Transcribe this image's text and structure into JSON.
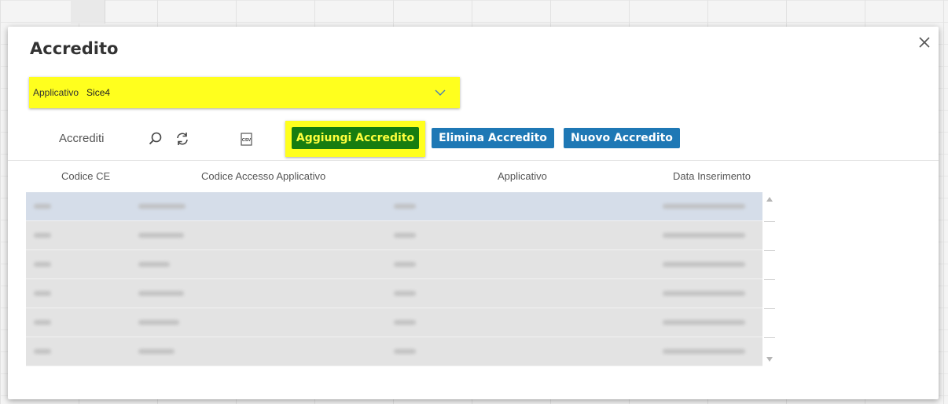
{
  "dialog": {
    "title": "Accredito"
  },
  "applicativo_select": {
    "label": "Applicativo",
    "value": "Sice4"
  },
  "toolbar": {
    "title": "Accrediti",
    "aggiungi_label": "Aggiungi Accredito",
    "elimina_label": "Elimina Accredito",
    "nuovo_label": "Nuovo Accredito",
    "icons": [
      "search-icon",
      "refresh-icon",
      "csv-export-icon"
    ]
  },
  "table": {
    "columns": [
      "Codice CE",
      "Codice Accesso Applicativo",
      "Applicativo",
      "Data Inserimento"
    ],
    "selected_row": 0
  },
  "colors": {
    "highlight": "#ffff1e",
    "primary_button": "#1e78b5",
    "add_button": "#177d10",
    "selected_row": "#d5dde9"
  }
}
